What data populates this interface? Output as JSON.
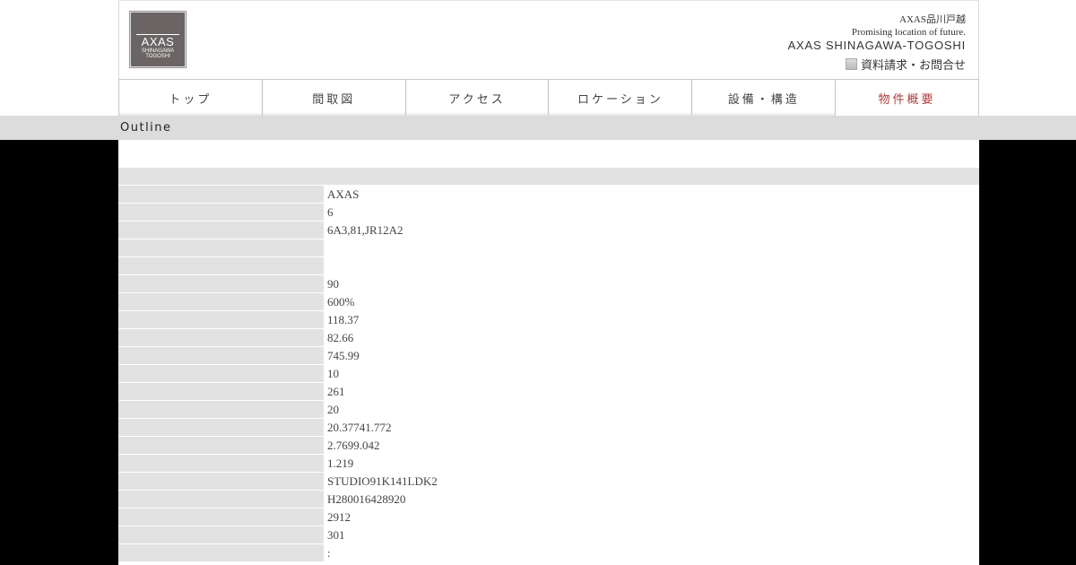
{
  "header": {
    "logo": {
      "name": "AXAS",
      "sub1": "SHINAGAWA",
      "sub2": "TOGOSHI"
    },
    "site_name": "AXAS品川戸越",
    "tagline": "Promising location of future.",
    "title_en": "AXAS SHINAGAWA-TOGOSHI",
    "contact_label": "資料請求・お問合せ"
  },
  "nav": {
    "items": [
      {
        "label": "トップ"
      },
      {
        "label": "間取図"
      },
      {
        "label": "アクセス"
      },
      {
        "label": "ロケーション"
      },
      {
        "label": "設備・構造"
      },
      {
        "label": "物件概要"
      }
    ],
    "active_color": "#b23a3a"
  },
  "section": {
    "title": "Outline"
  },
  "table": {
    "values": [
      "AXAS",
      "6",
      "6A3,81,JR12A2",
      "",
      "",
      "90",
      "600%",
      "118.37",
      "82.66",
      "745.99",
      "10",
      "261",
      "20",
      "20.37741.772",
      "2.7699.042",
      "1.219",
      "STUDIO91K141LDK2",
      "H280016428920",
      "2912",
      "301",
      ":"
    ]
  }
}
